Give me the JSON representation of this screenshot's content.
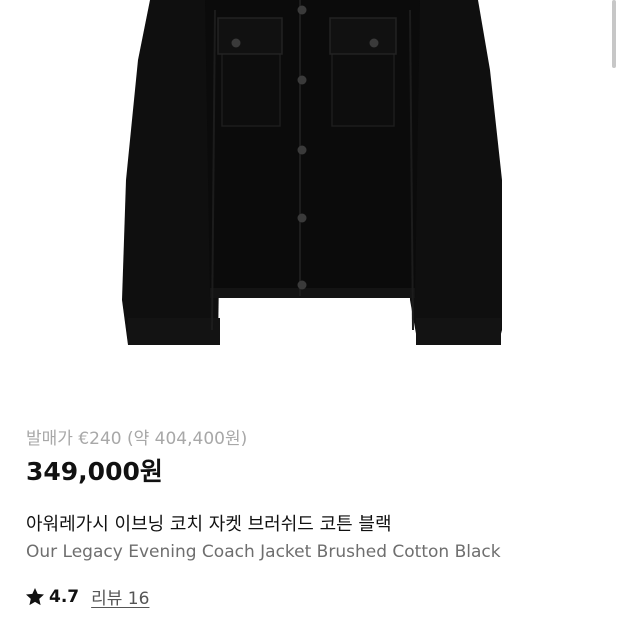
{
  "product": {
    "image_alt": "Our Legacy Evening Coach Jacket Brushed Cotton Black",
    "release_price": "발매가 €240 (약 404,400원)",
    "sale_price": "349,000원",
    "title_ko": "아워레가시 이브닝 코치 자켓 브러쉬드 코튼 블랙",
    "title_en": "Our Legacy Evening Coach Jacket Brushed Cotton Black"
  },
  "rating": {
    "icon": "star-icon",
    "value": "4.7",
    "review_label": "리뷰 16"
  },
  "colors": {
    "jacket": "#0c0c0c",
    "price": "#111111",
    "muted": "#a8a8a8",
    "subtitle": "#6e6e6e"
  }
}
